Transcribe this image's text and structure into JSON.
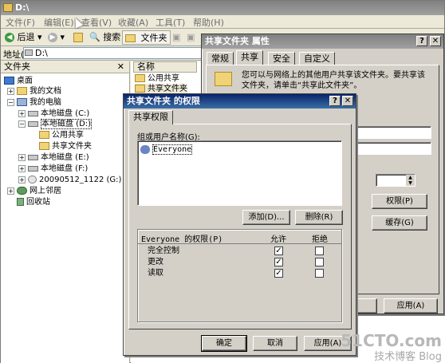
{
  "explorer": {
    "title": "D:\\",
    "menu": [
      "文件(F)",
      "编辑(E)",
      "查看(V)",
      "收藏(A)",
      "工具(T)",
      "帮助(H)"
    ],
    "toolbar": {
      "back": "后退",
      "search": "搜索",
      "folders": "文件夹"
    },
    "address_label": "地址(D)",
    "address_value": "D:\\",
    "folders_pane_title": "文件夹",
    "tree": {
      "desktop": "桌面",
      "my_docs": "我的文档",
      "my_computer": "我的电脑",
      "drive_c": "本地磁盘 (C:)",
      "drive_d": "本地磁盘 (D:)",
      "folder_public": "公用共享",
      "folder_shared": "共享文件夹",
      "drive_e": "本地磁盘 (E:)",
      "drive_f": "本地磁盘 (F:)",
      "drive_g": "20090512_1122 (G:)",
      "network": "网上邻居",
      "recycle": "回收站"
    },
    "list_header": "名称",
    "list_items": [
      "公用共享",
      "共享文件夹"
    ]
  },
  "properties": {
    "title": "共享文件夹 属性",
    "tabs": [
      "常规",
      "共享",
      "安全",
      "自定义"
    ],
    "description": "您可以与网络上的其他用户共享该文件夹。要共享该文件夹，请单击“共享此文件夹”。",
    "permissions_button": "权限(P)",
    "caching_button": "缓存(G)",
    "apply_button": "应用(A)"
  },
  "permissions": {
    "title": "共享文件夹 的权限",
    "tab": "共享权限",
    "group_label": "组或用户名称(G):",
    "users": [
      "Everyone"
    ],
    "add_button": "添加(D)...",
    "remove_button": "删除(R)",
    "perm_label": "Everyone 的权限(P)",
    "allow_header": "允许",
    "deny_header": "拒绝",
    "rows": [
      {
        "name": "完全控制",
        "allow": "✓",
        "deny": ""
      },
      {
        "name": "更改",
        "allow": "✓",
        "deny": ""
      },
      {
        "name": "读取",
        "allow": "✓",
        "deny": ""
      }
    ],
    "ok_button": "确定",
    "cancel_button": "取消",
    "apply_button": "应用(A)"
  },
  "watermark": {
    "line1": "51CTO.com",
    "line2": "技术博客 Blog"
  }
}
